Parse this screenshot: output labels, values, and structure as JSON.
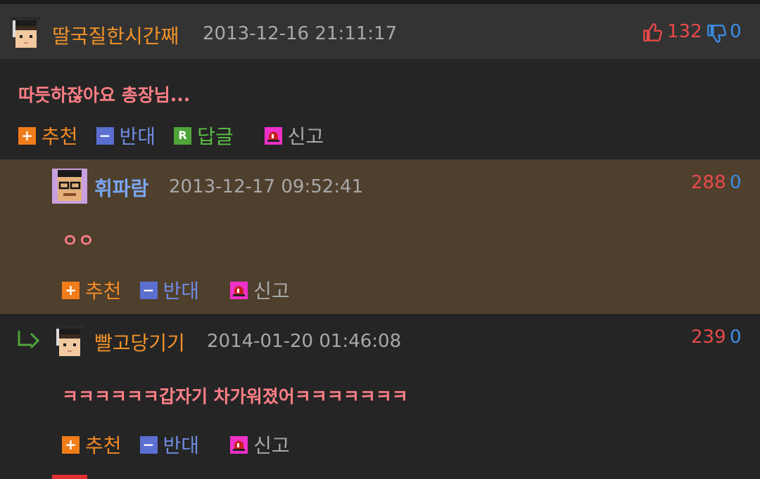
{
  "comments": [
    {
      "nickname": "딸국질한시간째",
      "date": "2013-12-16 21:11:17",
      "up": "132",
      "down": "0",
      "body": "따듯하잖아요 총장님...",
      "actions": {
        "recommend": "추천",
        "oppose": "반대",
        "reply": "답글",
        "report": "신고"
      }
    },
    {
      "nickname": "휘파람",
      "date": "2013-12-17 09:52:41",
      "up": "288",
      "down": "0",
      "body": "ㅇㅇ",
      "actions": {
        "recommend": "추천",
        "oppose": "반대",
        "report": "신고"
      }
    },
    {
      "nickname": "빨고당기기",
      "date": "2014-01-20 01:46:08",
      "up": "239",
      "down": "0",
      "body": "ㅋㅋㅋㅋㅋㅋ갑자기 차가워졌어ㅋㅋㅋㅋㅋㅋㅋ",
      "actions": {
        "recommend": "추천",
        "oppose": "반대",
        "report": "신고"
      }
    }
  ],
  "icons": {
    "avatar_1": "pixel-student-avatar",
    "avatar_2": "pixel-glasses-man-avatar",
    "avatar_3": "pixel-student-avatar",
    "thumb_up": "thumb-up-icon",
    "thumb_down": "thumb-down-icon",
    "reply_arrow": "reply-arrow-icon",
    "recommend": "plus-icon",
    "oppose": "minus-icon",
    "reply": "r-icon",
    "report": "siren-icon"
  },
  "colors": {
    "nick_orange": "#f0922a",
    "nick_blue": "#7aa7f0",
    "body_pink": "#ff7f86",
    "up_red": "#e84a4a",
    "down_blue": "#3a8ee6",
    "reply_bg": "#4f3f2d"
  }
}
